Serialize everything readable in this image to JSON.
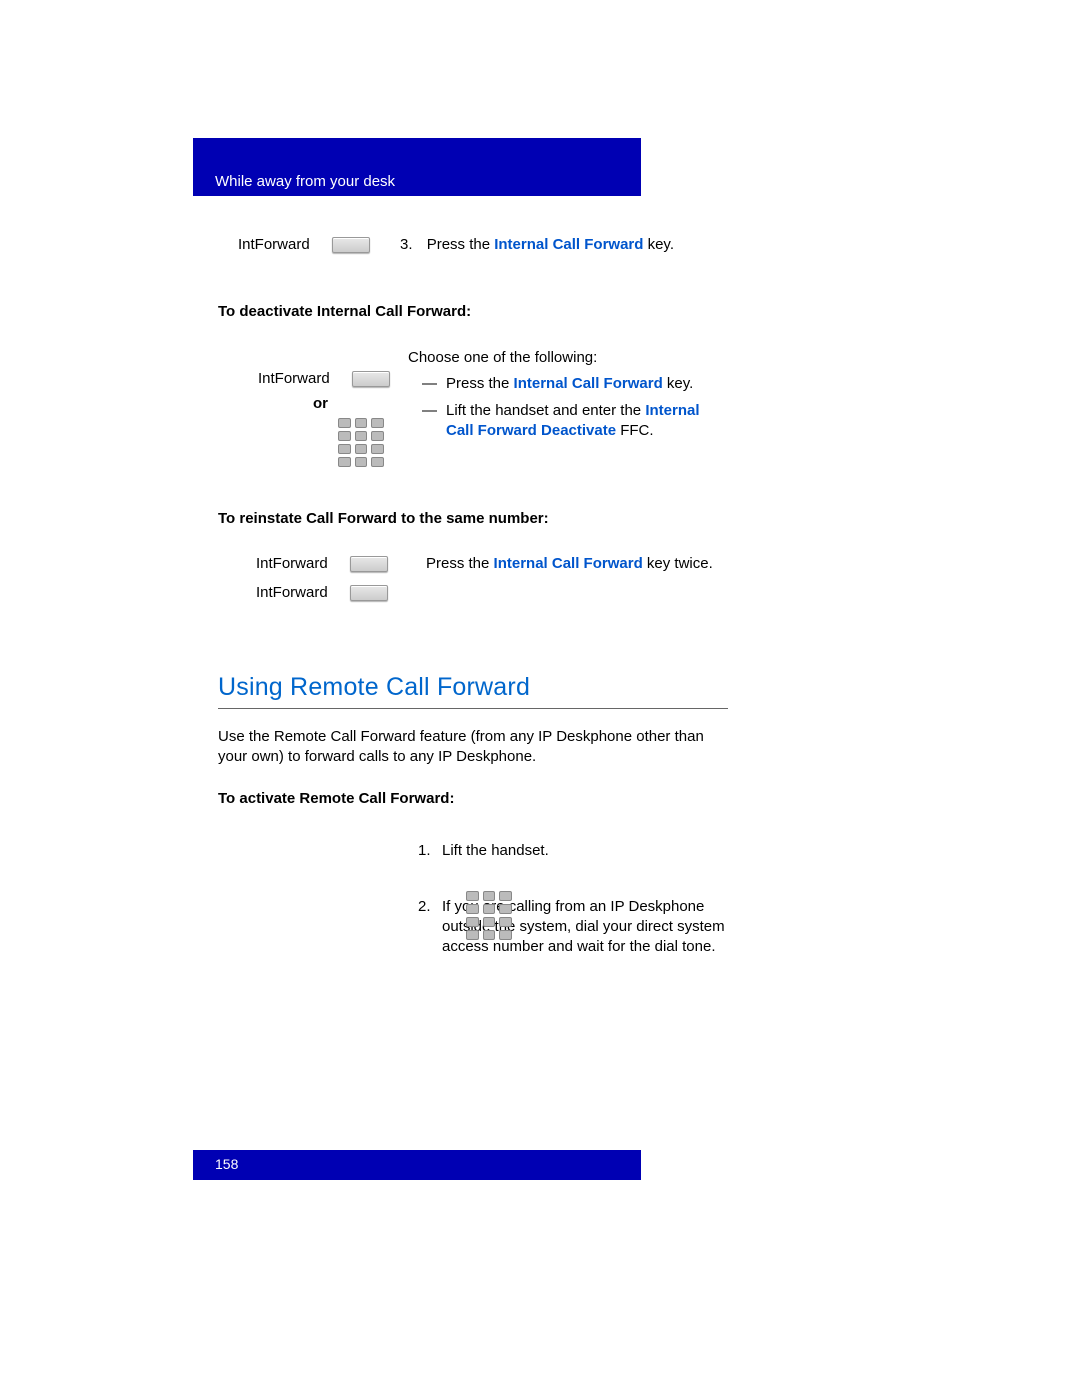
{
  "header": {
    "title": "While away from your desk"
  },
  "step3": {
    "label": "IntForward",
    "num": "3.",
    "text_prefix": "Press the ",
    "link": "Internal Call Forward",
    "text_suffix": " key."
  },
  "deactivate": {
    "heading": "To deactivate Internal Call Forward:",
    "left_label": "IntForward",
    "or": "or",
    "choose": "Choose one of the following:",
    "opt1_prefix": "Press the ",
    "opt1_link": "Internal Call Forward",
    "opt1_suffix": " key.",
    "opt2_prefix": "Lift the handset and enter the ",
    "opt2_link": "Internal Call Forward Deactivate",
    "opt2_suffix": " FFC."
  },
  "reinstate": {
    "heading": "To reinstate Call Forward to the same number:",
    "label1": "IntForward",
    "label2": "IntForward",
    "text_prefix": "Press the ",
    "link": "Internal Call Forward",
    "text_suffix": " key twice."
  },
  "section": {
    "title": "Using Remote Call Forward",
    "para": "Use the Remote Call Forward feature (from any IP Deskphone other than your own) to forward calls to any IP Deskphone."
  },
  "activate": {
    "heading": "To activate Remote Call Forward:",
    "item1_num": "1.",
    "item1_text": "Lift the handset.",
    "item2_num": "2.",
    "item2_text": "If you are calling from an IP Deskphone outside the system, dial your direct system access number and wait for the dial tone."
  },
  "footer": {
    "page": "158"
  }
}
